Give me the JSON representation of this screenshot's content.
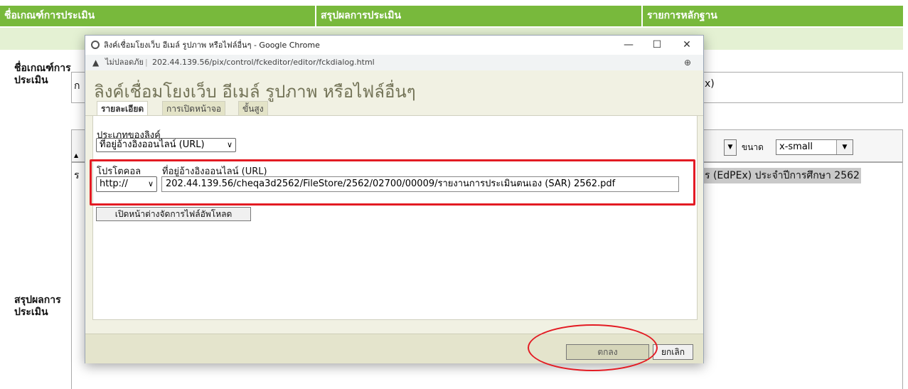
{
  "background": {
    "header": {
      "col1": "ชื่อเกณฑ์การประเมิน",
      "col2": "สรุปผลการประเมิน",
      "col3": "รายการหลักฐาน"
    },
    "left_labels": {
      "criteria_name": "ชื่อเกณฑ์การประเมิน",
      "result_summary": "สรุปผลการประเมิน"
    },
    "criteria_field_prefix": "ก",
    "criteria_field_suffix": "x)",
    "toolbar": {
      "size_label": "ขนาด",
      "size_value": "x-small"
    },
    "body_text_prefix": "ร",
    "body_text_suffix": "ร (EdPEx)  ประจำปีการศึกษา 2562"
  },
  "popup": {
    "window_title": "ลิงค์เชื่อมโยงเว็บ อีเมล์ รูปภาพ หรือไฟล์อื่นๆ - Google Chrome",
    "security_label": "ไม่ปลอดภัย",
    "url": "202.44.139.56/pix/control/fckeditor/editor/fckdialog.html",
    "dialog": {
      "title": "ลิงค์เชื่อมโยงเว็บ อีเมล์ รูปภาพ หรือไฟล์อื่นๆ",
      "tabs": [
        "รายละเอียด",
        "การเปิดหน้าจอ",
        "ขั้นสูง"
      ],
      "link_type_label": "ประเภทของลิงค์",
      "link_type_value": "ที่อยู่อ้างอิงออนไลน์ (URL)",
      "protocol_label": "โปรโตคอล",
      "protocol_value": "http://",
      "url_label": "ที่อยู่อ้างอิงออนไลน์ (URL)",
      "url_value": "202.44.139.56/cheqa3d2562/FileStore/2562/02700/00009/รายงานการประเมินตนเอง (SAR) 2562.pdf",
      "browse_button": "เปิดหน้าต่างจัดการไฟล์อัพโหลด",
      "ok_button": "ตกลง",
      "cancel_button": "ยกเลิก"
    }
  },
  "colors": {
    "header_green": "#78b93c",
    "subrow_green": "#e4f1d3",
    "dialog_bg": "#f1f1e3",
    "annotation_red": "#e31b23"
  },
  "icons": [
    "chrome-icon",
    "warning-icon",
    "zoom-icon",
    "minimize-icon",
    "maximize-icon",
    "close-icon"
  ]
}
